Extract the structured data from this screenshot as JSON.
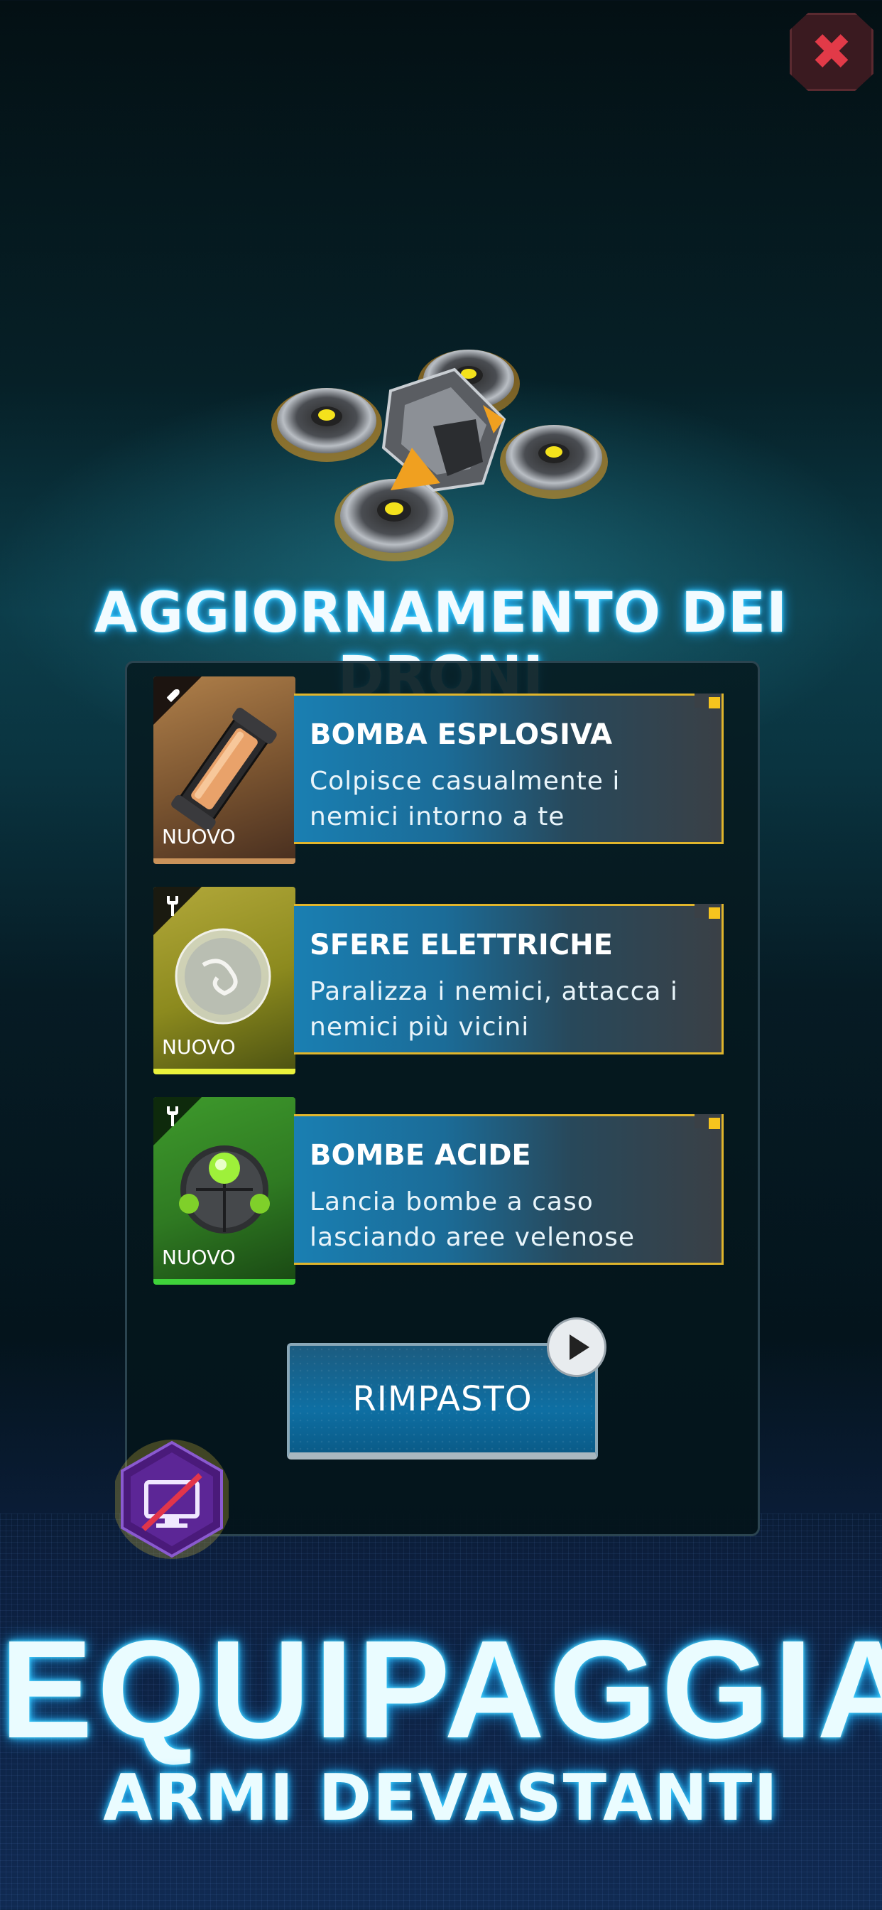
{
  "header": {
    "close_icon": "close-icon"
  },
  "hero": {
    "image": "drone-illustration",
    "title": "AGGIORNAMENTO DEI DRONI"
  },
  "upgrades": [
    {
      "name": "BOMBA ESPLOSIVA",
      "description": "Colpisce casualmente i nemici intorno a te",
      "badge": "NUOVO",
      "type_icon": "bullet-icon",
      "item_icon": "bomb-canister-icon",
      "color": "#7a5430"
    },
    {
      "name": "SFERE ELETTRICHE",
      "description": "Paralizza i nemici, attacca i nemici più vicini",
      "badge": "NUOVO",
      "type_icon": "wrench-icon",
      "item_icon": "electric-sphere-icon",
      "color": "#8c8a1e"
    },
    {
      "name": "BOMBE ACIDE",
      "description": "Lancia bombe a caso lasciando aree velenose",
      "badge": "NUOVO",
      "type_icon": "wrench-icon",
      "item_icon": "acid-bomb-icon",
      "color": "#2f7a22"
    }
  ],
  "actions": {
    "reshuffle_label": "RIMPASTO",
    "video_icon": "play-icon"
  },
  "no_ads_icon": "no-ads-icon",
  "promo": {
    "headline": "EQUIPAGGIA",
    "subheadline": "ARMI DEVASTANTI"
  },
  "colors": {
    "accent": "#f6c41e",
    "card_blue": "#1a7fb2",
    "glow": "#3bd4ff"
  }
}
